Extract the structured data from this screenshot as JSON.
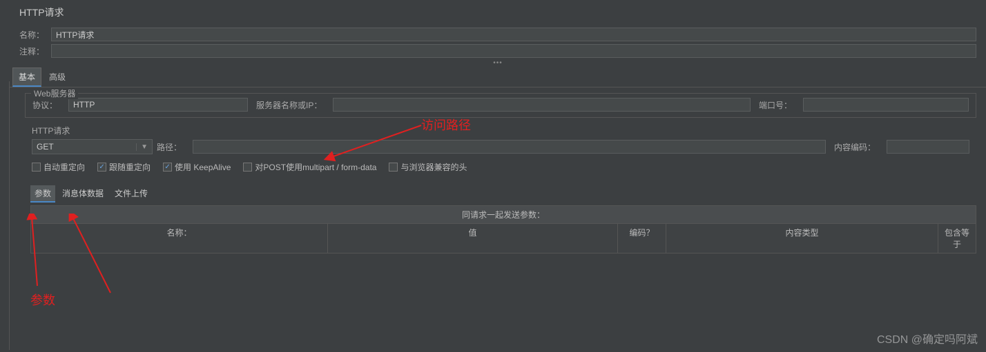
{
  "header": {
    "title": "HTTP请求"
  },
  "fields": {
    "name_label": "名称：",
    "name_value": "HTTP请求",
    "comment_label": "注释：",
    "comment_value": ""
  },
  "main_tabs": [
    {
      "label": "基本",
      "active": true
    },
    {
      "label": "高级",
      "active": false
    }
  ],
  "web_server": {
    "title": "Web服务器",
    "protocol_label": "协议：",
    "protocol_value": "HTTP",
    "server_label": "服务器名称或IP：",
    "server_value": "",
    "port_label": "端口号：",
    "port_value": ""
  },
  "http_request": {
    "title": "HTTP请求",
    "method_value": "GET",
    "path_label": "路径：",
    "path_value": "",
    "encoding_label": "内容编码：",
    "encoding_value": ""
  },
  "checkboxes": [
    {
      "label": "自动重定向",
      "checked": false
    },
    {
      "label": "跟随重定向",
      "checked": true
    },
    {
      "label": "使用 KeepAlive",
      "checked": true
    },
    {
      "label": "对POST使用multipart / form-data",
      "checked": false
    },
    {
      "label": "与浏览器兼容的头",
      "checked": false
    }
  ],
  "param_tabs": [
    {
      "label": "参数",
      "active": true
    },
    {
      "label": "消息体数据",
      "active": false
    },
    {
      "label": "文件上传",
      "active": false
    }
  ],
  "table": {
    "title": "同请求一起发送参数：",
    "columns": [
      "名称：",
      "值",
      "编码？",
      "内容类型",
      "包含等于"
    ]
  },
  "annotations": {
    "path": "访问路径",
    "params": "参数"
  },
  "watermark": "CSDN @确定吗阿斌"
}
